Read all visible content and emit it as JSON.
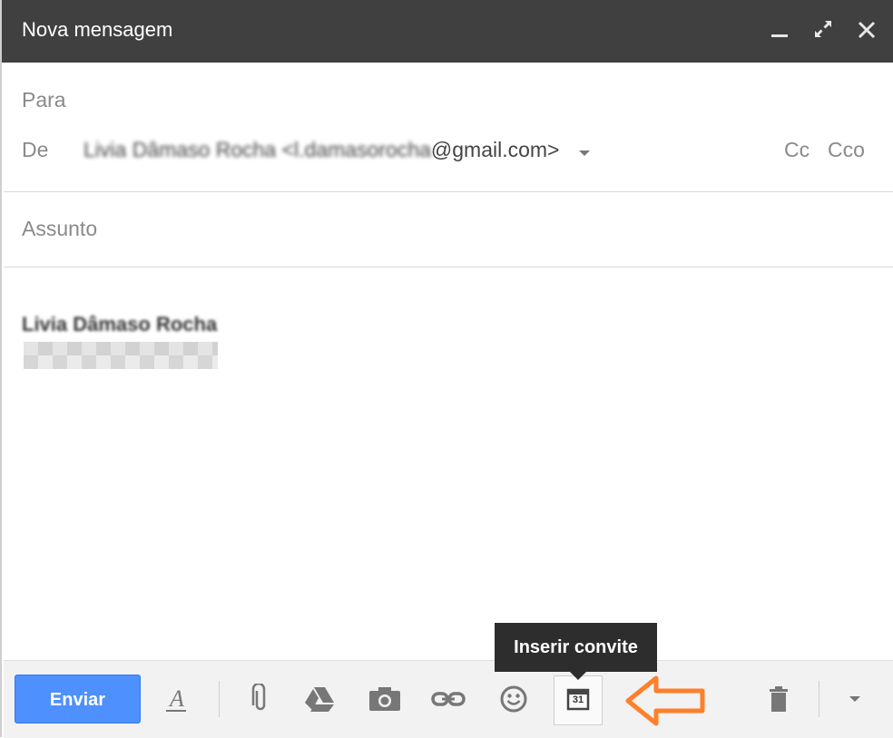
{
  "window": {
    "title": "Nova mensagem",
    "controls": {
      "minimize_icon": "minimize-icon",
      "maximize_icon": "expand-icon",
      "close_icon": "close-icon"
    }
  },
  "header": {
    "to_label": "Para",
    "from_label": "De",
    "from_name": "Livia Dâmaso Rocha",
    "from_email_prefix": "<l.damasorocha",
    "from_email_domain": "@gmail.com>",
    "cc_label": "Cc",
    "bcc_label": "Cco"
  },
  "subject": {
    "placeholder": "Assunto"
  },
  "body": {
    "signature_name": "Livia Dâmaso Rocha"
  },
  "toolbar": {
    "send_label": "Enviar",
    "tooltip_text": "Inserir convite",
    "calendar_day": "31",
    "icons": [
      "format-text-icon",
      "attach-icon",
      "drive-icon",
      "photo-icon",
      "link-icon",
      "emoji-icon",
      "calendar-invite-icon",
      "trash-icon",
      "more-options-icon"
    ]
  },
  "colors": {
    "titlebar": "#404040",
    "send_button": "#4d90fe",
    "annotation_arrow": "#ff7f2a"
  }
}
